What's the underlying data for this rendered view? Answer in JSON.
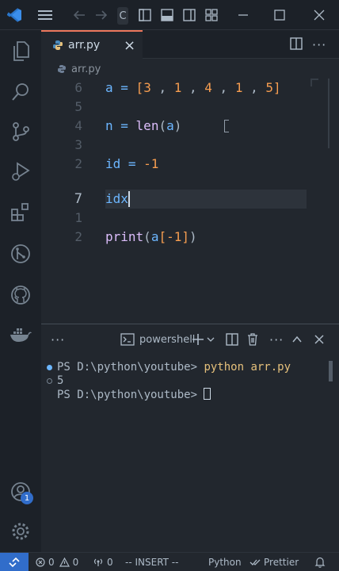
{
  "titlebar": {
    "search_fragment": "C"
  },
  "tab": {
    "filename": "arr.py",
    "close": "×"
  },
  "breadcrumb": {
    "file": "arr.py"
  },
  "editor": {
    "lines": [
      {
        "num": "6"
      },
      {
        "num": "5"
      },
      {
        "num": "4"
      },
      {
        "num": "3"
      },
      {
        "num": "2"
      },
      {
        "num": "7"
      },
      {
        "num": "1"
      },
      {
        "num": "2"
      }
    ],
    "code": {
      "l1_var": "a",
      "l1_eq": " = ",
      "l1_open": "[",
      "l1_n1": "3",
      "l1_c1": " , ",
      "l1_n2": "1",
      "l1_c2": " , ",
      "l1_n3": "4",
      "l1_c3": " , ",
      "l1_n4": "1",
      "l1_c4": " , ",
      "l1_n5": "5",
      "l1_close": "]",
      "l3_var": "n",
      "l3_eq": " = ",
      "l3_fn": "len",
      "l3_open": "(",
      "l3_arg": "a",
      "l3_close": ")",
      "l5_var": "id",
      "l5_eq": " = ",
      "l5_val": "-1",
      "l6_text": "idx",
      "l8_fn": "print",
      "l8_open": "(",
      "l8_arg": "a",
      "l8_br1": "[",
      "l8_val": "-1",
      "l8_br2": "]",
      "l8_close": ")"
    }
  },
  "panel": {
    "shell": "powershell",
    "terminal": {
      "line1_prompt": "PS D:\\python\\youtube> ",
      "line1_cmd": "python arr.py",
      "line2": "5",
      "line3_prompt": "PS D:\\python\\youtube> "
    }
  },
  "status": {
    "errors": "0",
    "warnings": "0",
    "ports": "0",
    "mode": "-- INSERT --",
    "language": "Python",
    "formatter": "Prettier"
  },
  "accounts_badge": "1",
  "colors": {
    "accent": "#316dca",
    "tab_border": "#ec775c",
    "number": "#f69d50",
    "identifier": "#6cb6ff"
  }
}
